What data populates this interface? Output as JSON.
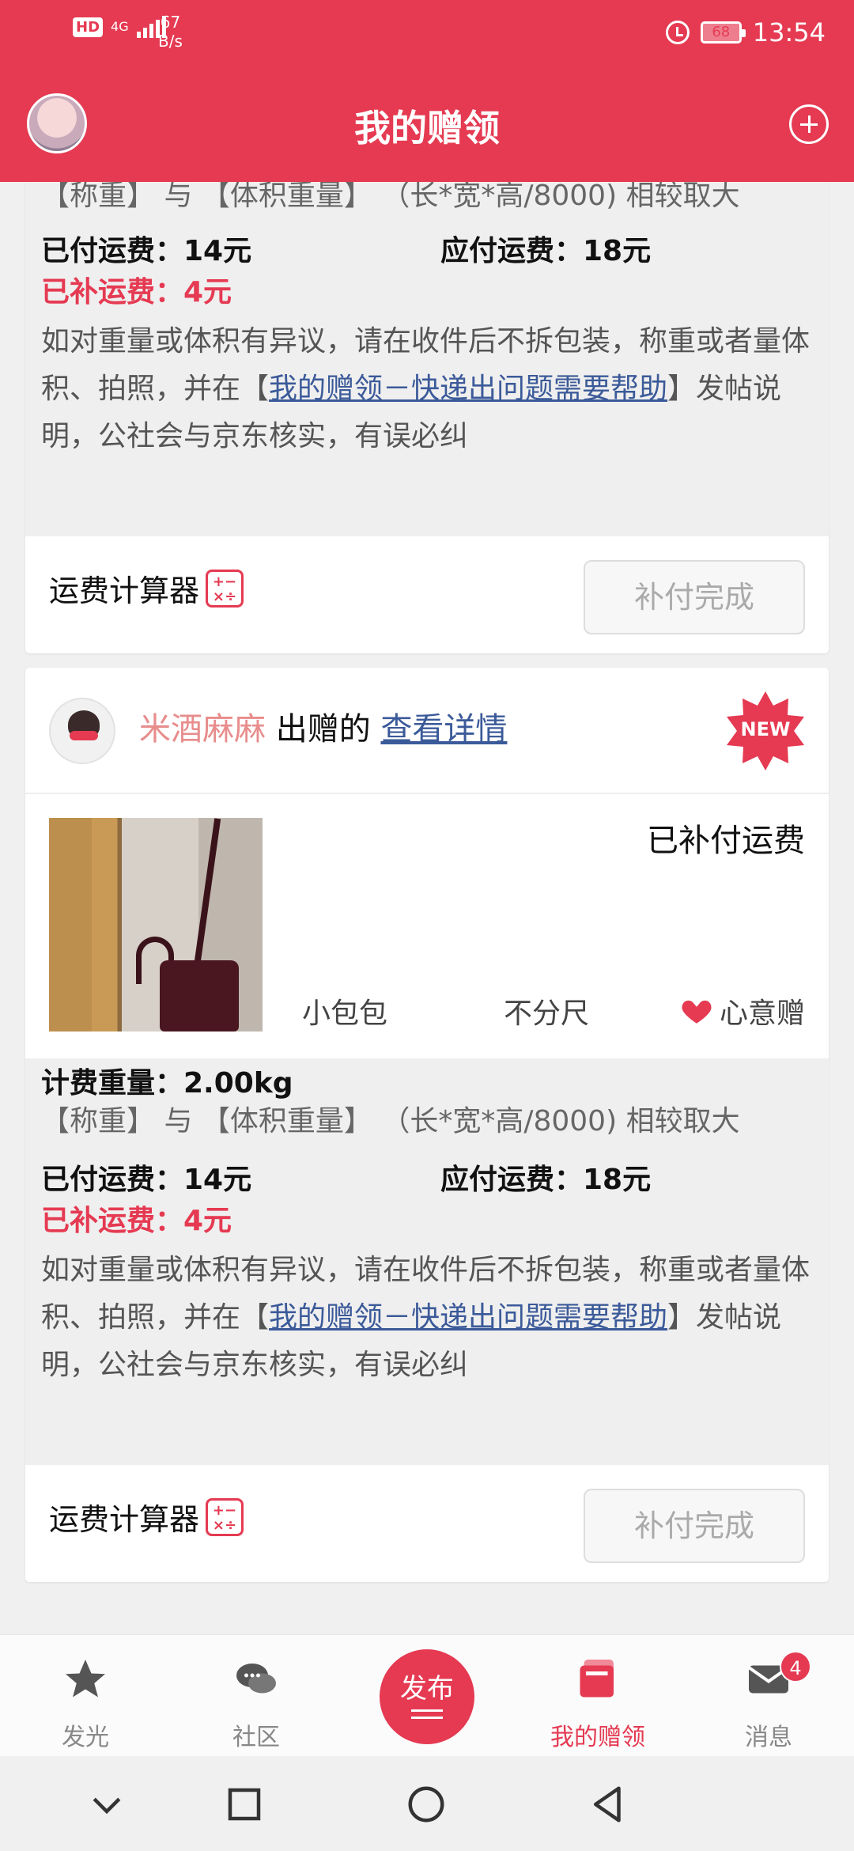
{
  "status_bar": {
    "hd": "HD",
    "network": "4G",
    "speed_value": "67",
    "speed_unit": "B/s",
    "battery": "68",
    "time": "13:54"
  },
  "header": {
    "title": "我的赠领",
    "add_icon": "plus-circle-icon"
  },
  "card1": {
    "rule_text": "【称重】 与 【体积重量】 （长*宽*高/8000) 相较取大",
    "paid_label": "已付运费：14元",
    "due_label": "应付运费：18元",
    "supplement_label": "已补运费：4元",
    "notice_part1": "如对重量或体积有异议，请在收件后不拆包装，称重或者量体积、拍照，并在【",
    "notice_link": "我的赠领－快递出问题需要帮助",
    "notice_part2": "】发帖说明，公社会与京东核实，有误必纠",
    "calculator_label": "运费计算器",
    "done_button": "补付完成"
  },
  "card2": {
    "giver_name": "米酒麻麻",
    "giver_suffix": "出赠的",
    "detail_link": "查看详情",
    "new_badge": "NEW",
    "status": "已补付运费",
    "item_name": "小包包",
    "item_size": "不分尺",
    "item_type": "心意赠",
    "weight_label": "计费重量：2.00kg",
    "rule_text": "【称重】 与 【体积重量】 （长*宽*高/8000) 相较取大",
    "paid_label": "已付运费：14元",
    "due_label": "应付运费：18元",
    "supplement_label": "已补运费：4元",
    "notice_part1": "如对重量或体积有异议，请在收件后不拆包装，称重或者量体积、拍照，并在【",
    "notice_link": "我的赠领－快递出问题需要帮助",
    "notice_part2": "】发帖说明，公社会与京东核实，有误必纠",
    "calculator_label": "运费计算器",
    "done_button": "补付完成"
  },
  "tabbar": {
    "tabs": [
      {
        "label": "发光",
        "icon": "star-icon"
      },
      {
        "label": "社区",
        "icon": "chat-bubbles-icon"
      },
      {
        "label": "发布",
        "icon": "publish-icon"
      },
      {
        "label": "我的赠领",
        "icon": "cards-icon"
      },
      {
        "label": "消息",
        "icon": "mail-icon"
      }
    ],
    "message_badge": "4",
    "active_color": "#e53a52"
  }
}
